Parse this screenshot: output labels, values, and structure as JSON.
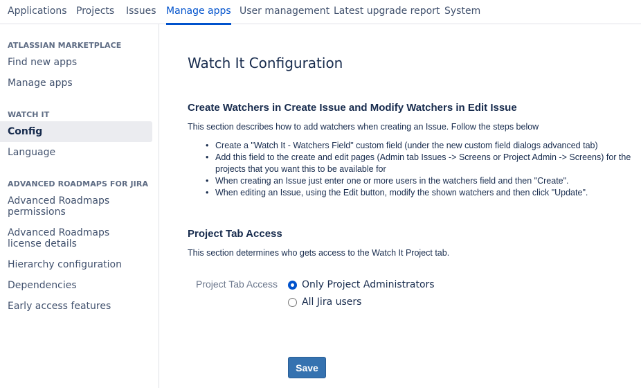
{
  "topnav": {
    "tabs": [
      {
        "label": "Applications"
      },
      {
        "label": "Projects"
      },
      {
        "label": "Issues"
      },
      {
        "label": "Manage apps",
        "active": true
      },
      {
        "label": "User management"
      },
      {
        "label": "Latest upgrade report"
      },
      {
        "label": "System"
      }
    ]
  },
  "sidebar": {
    "sections": [
      {
        "heading": "ATLASSIAN MARKETPLACE",
        "items": [
          "Find new apps",
          "Manage apps"
        ]
      },
      {
        "heading": "WATCH IT",
        "items": [
          "Config",
          "Language"
        ],
        "selected": "Config"
      },
      {
        "heading": "ADVANCED ROADMAPS FOR JIRA",
        "items": [
          "Advanced Roadmaps permissions",
          "Advanced Roadmaps license details",
          "Hierarchy configuration",
          "Dependencies",
          "Early access features"
        ]
      }
    ]
  },
  "main": {
    "title": "Watch It Configuration",
    "create_watchers": {
      "title": "Create Watchers in Create Issue and Modify Watchers in Edit Issue",
      "description": "This section describes how to add watchers when creating an Issue. Follow the steps below",
      "steps": [
        "Create a \"Watch It - Watchers Field\" custom field (under the new custom field dialogs advanced tab)",
        "Add this field to the create and edit pages (Admin tab Issues -> Screens or Project Admin -> Screens) for the projects that you want this to be available for",
        "When creating an Issue just enter one or more users in the watchers field and then \"Create\".",
        "When editing an Issue, using the Edit button, modify the shown watchers and then click \"Update\"."
      ]
    },
    "project_tab": {
      "title": "Project Tab Access",
      "description": "This section determines who gets access to the Watch It Project tab.",
      "field_label": "Project Tab Access",
      "options": [
        {
          "label": "Only Project Administrators",
          "checked": true
        },
        {
          "label": "All Jira users",
          "checked": false
        }
      ]
    },
    "save_label": "Save"
  },
  "colors": {
    "accent": "#0052cc",
    "button": "#3572b0",
    "sidebar_selected": "#ebecf0",
    "text": "#172b4d"
  }
}
